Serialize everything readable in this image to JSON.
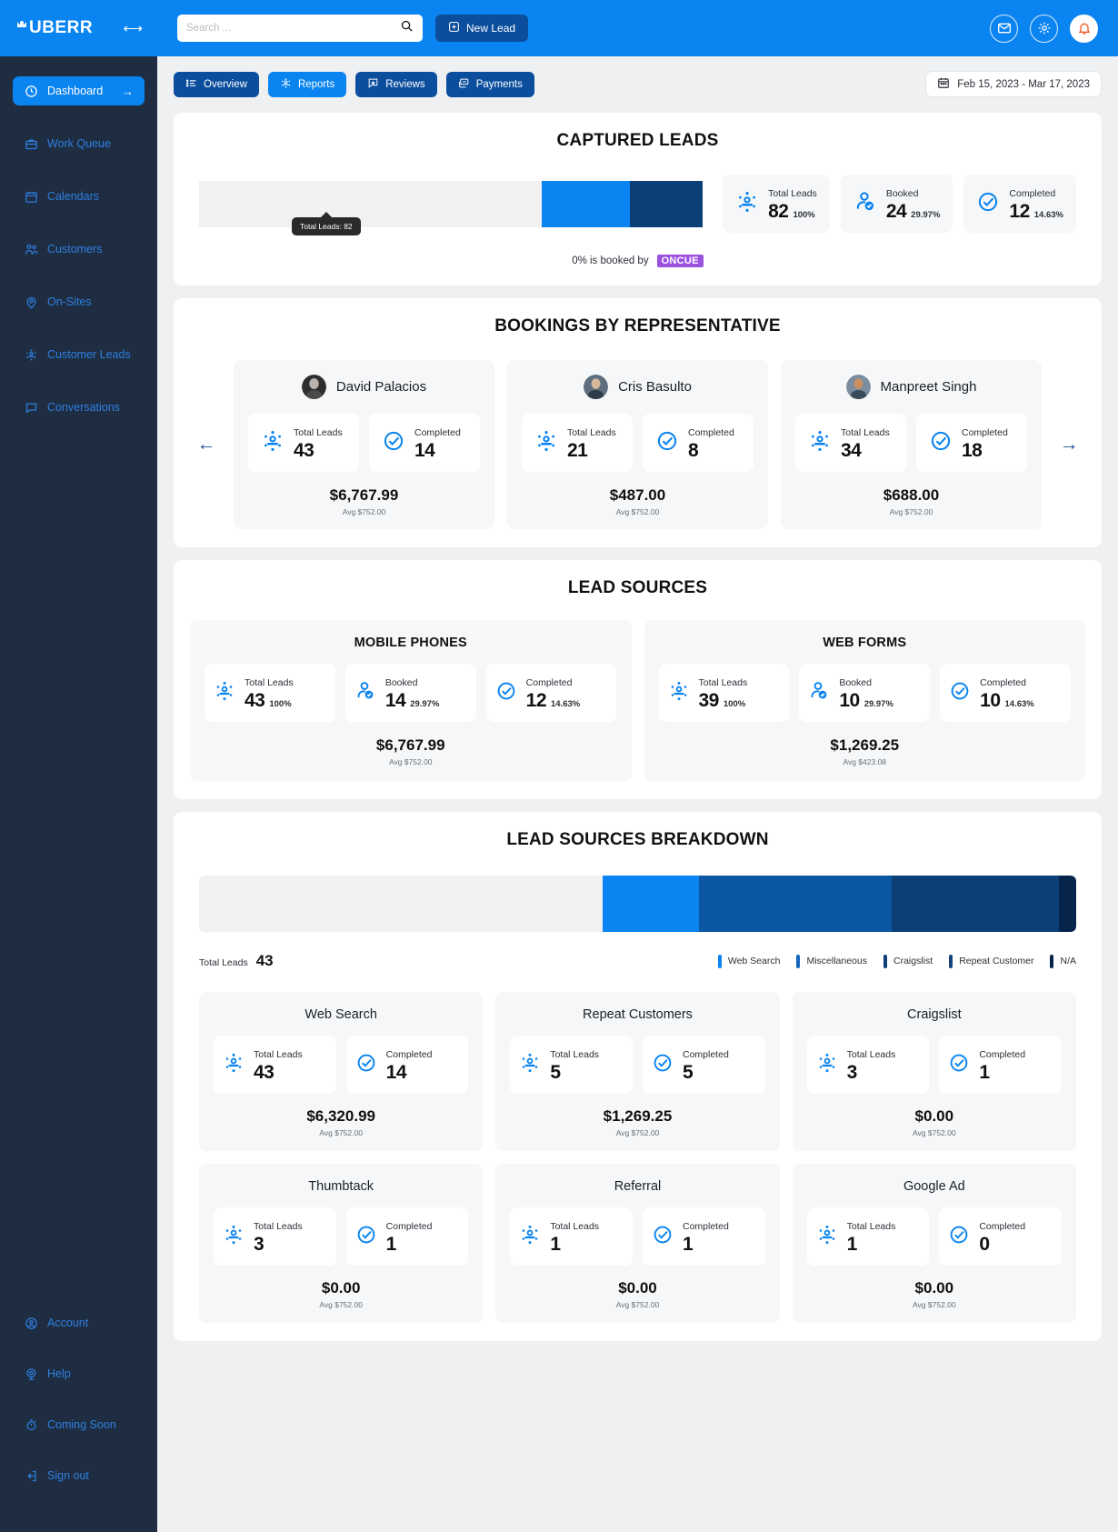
{
  "brand": {
    "name": "UBERR",
    "collapse_icon": "collapse-sidebar-icon"
  },
  "sidebar": {
    "items": [
      {
        "label": "Dashboard",
        "icon": "clock-icon",
        "active": true,
        "arrow": "→"
      },
      {
        "label": "Work Queue",
        "icon": "briefcase-icon",
        "active": false
      },
      {
        "label": "Calendars",
        "icon": "calendar-icon",
        "active": false
      },
      {
        "label": "Customers",
        "icon": "users-icon",
        "active": false
      },
      {
        "label": "On-Sites",
        "icon": "map-pin-icon",
        "active": false
      },
      {
        "label": "Customer Leads",
        "icon": "leads-icon",
        "active": false
      },
      {
        "label": "Conversations",
        "icon": "chat-icon",
        "active": false
      }
    ],
    "bottom_items": [
      {
        "label": "Account",
        "icon": "account-icon"
      },
      {
        "label": "Help",
        "icon": "help-icon"
      },
      {
        "label": "Coming Soon",
        "icon": "stopwatch-icon"
      },
      {
        "label": "Sign out",
        "icon": "signout-icon"
      }
    ]
  },
  "topbar": {
    "search_placeholder": "Search ...",
    "search_value": "",
    "new_lead_label": "New Lead",
    "icons": [
      "mail-icon",
      "gear-icon",
      "bell-icon"
    ]
  },
  "tabs": [
    {
      "label": "Overview",
      "icon": "list-icon",
      "active": false
    },
    {
      "label": "Reports",
      "icon": "reports-icon",
      "active": true
    },
    {
      "label": "Reviews",
      "icon": "star-badge-icon",
      "active": false
    },
    {
      "label": "Payments",
      "icon": "payments-icon",
      "active": false
    }
  ],
  "date_range": "Feb 15, 2023 - Mar 17, 2023",
  "captured_leads": {
    "title": "CAPTURED LEADS",
    "tooltip": "Total Leads: 82",
    "booked_by_text": "0% is booked by",
    "booked_by_brand": "ONCUE",
    "stats": [
      {
        "label": "Total Leads",
        "value": "82",
        "pct": "100%",
        "icon": "leads-icon"
      },
      {
        "label": "Booked",
        "value": "24",
        "pct": "29.97%",
        "icon": "user-check-icon"
      },
      {
        "label": "Completed",
        "value": "12",
        "pct": "14.63%",
        "icon": "check-circle-icon"
      }
    ]
  },
  "reps": {
    "title": "BOOKINGS BY REPRESENTATIVE",
    "prev_label": "←",
    "next_label": "→",
    "cards": [
      {
        "name": "David Palacios",
        "total_label": "Total Leads",
        "total": "43",
        "completed_label": "Completed",
        "completed": "14",
        "amount": "$6,767.99",
        "avg": "Avg $752.00",
        "avatar": "avatar-dark"
      },
      {
        "name": "Cris Basulto",
        "total_label": "Total Leads",
        "total": "21",
        "completed_label": "Completed",
        "completed": "8",
        "amount": "$487.00",
        "avg": "Avg $752.00",
        "avatar": "avatar-mid"
      },
      {
        "name": "Manpreet Singh",
        "total_label": "Total Leads",
        "total": "34",
        "completed_label": "Completed",
        "completed": "18",
        "amount": "$688.00",
        "avg": "Avg $752.00",
        "avatar": "avatar-warm"
      }
    ]
  },
  "lead_sources": {
    "title": "LEAD SOURCES",
    "panels": [
      {
        "title": "MOBILE PHONES",
        "stats": [
          {
            "label": "Total Leads",
            "value": "43",
            "pct": "100%",
            "icon": "leads-icon"
          },
          {
            "label": "Booked",
            "value": "14",
            "pct": "29.97%",
            "icon": "user-check-icon"
          },
          {
            "label": "Completed",
            "value": "12",
            "pct": "14.63%",
            "icon": "check-circle-icon"
          }
        ],
        "amount": "$6,767.99",
        "avg": "Avg $752.00"
      },
      {
        "title": "WEB FORMS",
        "stats": [
          {
            "label": "Total Leads",
            "value": "39",
            "pct": "100%",
            "icon": "leads-icon"
          },
          {
            "label": "Booked",
            "value": "10",
            "pct": "29.97%",
            "icon": "user-check-icon"
          },
          {
            "label": "Completed",
            "value": "10",
            "pct": "14.63%",
            "icon": "check-circle-icon"
          }
        ],
        "amount": "$1,269.25",
        "avg": "Avg $423.08"
      }
    ]
  },
  "breakdown": {
    "title": "LEAD SOURCES BREAKDOWN",
    "total_label": "Total Leads",
    "total_value": "43",
    "cards": [
      {
        "name": "Web Search",
        "total_label": "Total Leads",
        "total": "43",
        "completed_label": "Completed",
        "completed": "14",
        "amount": "$6,320.99",
        "avg": "Avg $752.00"
      },
      {
        "name": "Repeat Customers",
        "total_label": "Total Leads",
        "total": "5",
        "completed_label": "Completed",
        "completed": "5",
        "amount": "$1,269.25",
        "avg": "Avg $752.00"
      },
      {
        "name": "Craigslist",
        "total_label": "Total Leads",
        "total": "3",
        "completed_label": "Completed",
        "completed": "1",
        "amount": "$0.00",
        "avg": "Avg $752.00"
      },
      {
        "name": "Thumbtack",
        "total_label": "Total Leads",
        "total": "3",
        "completed_label": "Completed",
        "completed": "1",
        "amount": "$0.00",
        "avg": "Avg $752.00"
      },
      {
        "name": "Referral",
        "total_label": "Total Leads",
        "total": "1",
        "completed_label": "Completed",
        "completed": "1",
        "amount": "$0.00",
        "avg": "Avg $752.00"
      },
      {
        "name": "Google Ad",
        "total_label": "Total Leads",
        "total": "1",
        "completed_label": "Completed",
        "completed": "0",
        "amount": "$0.00",
        "avg": "Avg $752.00"
      }
    ]
  },
  "chart_data": [
    {
      "type": "bar",
      "title": "CAPTURED LEADS",
      "orientation": "horizontal-stacked",
      "categories": [
        "Remaining",
        "Booked",
        "Completed"
      ],
      "values": [
        68.0,
        17.5,
        14.5
      ],
      "colors": [
        "#f1f1f1",
        "#0a84f0",
        "#0c3f77"
      ],
      "annotation": "Total Leads: 82",
      "grid": false,
      "legend": "none"
    },
    {
      "type": "bar",
      "title": "LEAD SOURCES BREAKDOWN",
      "orientation": "horizontal-stacked",
      "categories": [
        "Remaining",
        "Web Search",
        "Miscellaneous",
        "Craigslist",
        "Repeat Customer",
        "N/A"
      ],
      "values": [
        46.0,
        11.0,
        22.0,
        14.0,
        5.0,
        2.0
      ],
      "colors": [
        "#f1f1f1",
        "#0a84f0",
        "#0b57a4",
        "#0c3f77",
        "#0c3f77",
        "#07254a"
      ],
      "legend_entries": [
        "Web Search",
        "Miscellaneous",
        "Craigslist",
        "Repeat Customer",
        "N/A"
      ],
      "legend_colors": [
        "#0a84f0",
        "#1566c0",
        "#0c3f77",
        "#14457e",
        "#07254a"
      ],
      "legend_position": "bottom-right",
      "total_label": "Total Leads",
      "total_value": 43,
      "grid": false
    }
  ],
  "colors": {
    "brand_blue": "#0a84f0",
    "dark_blue": "#0b4e9e",
    "sidebar": "#1e2d42",
    "purple": "#9b51e0"
  }
}
